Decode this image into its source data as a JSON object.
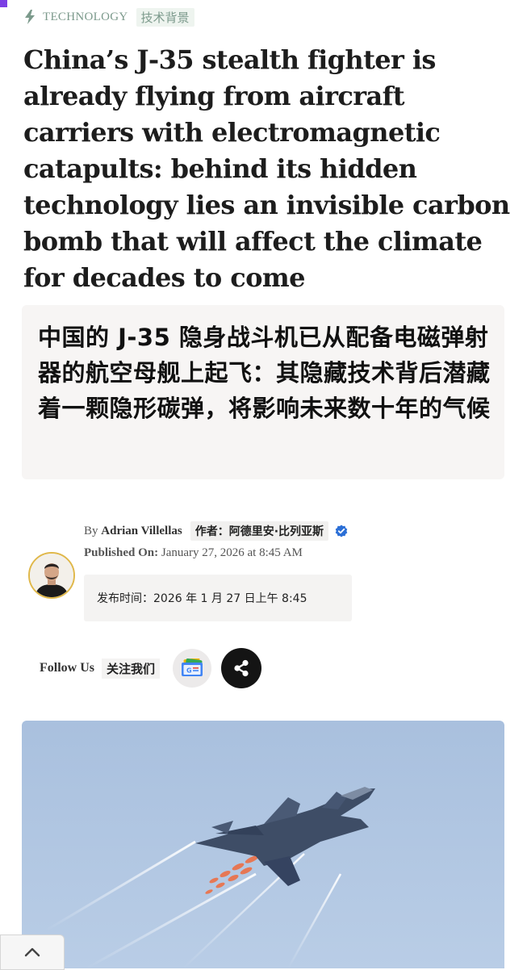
{
  "category": {
    "label": "TECHNOLOGY",
    "label_zh": "技术背景",
    "icon": "lightning-bolt-icon",
    "color": "#7c9a8c"
  },
  "headline": "China’s J-35 stealth fighter is already flying from aircraft carriers with electromagnetic catapults: behind its hidden technology lies an invisible carbon bomb that will affect the climate for decades to come",
  "headline_zh": "中国的 J-35 隐身战斗机已从配备电磁弹射器的航空母舰上起飞：其隐藏技术背后潜藏着一颗隐形碳弹，将影响未来数十年的气候",
  "author": {
    "by_prefix": "By",
    "name": "Adrian Villellas",
    "name_zh": "作者：阿德里安·比列亚斯",
    "verified_icon": "verified-check-icon",
    "verified_color": "#2b6fd6"
  },
  "published": {
    "label": "Published On:",
    "date": "January 27, 2026 at 8:45 AM",
    "date_zh": "发布时间：2026 年 1 月 27 日上午 8:45"
  },
  "follow": {
    "label": "Follow Us",
    "label_zh": "关注我们",
    "google_news_icon": "google-news-icon",
    "share_icon": "share-icon"
  },
  "scroll_top_icon": "chevron-up-icon",
  "accent_color": "#7b3fe4"
}
